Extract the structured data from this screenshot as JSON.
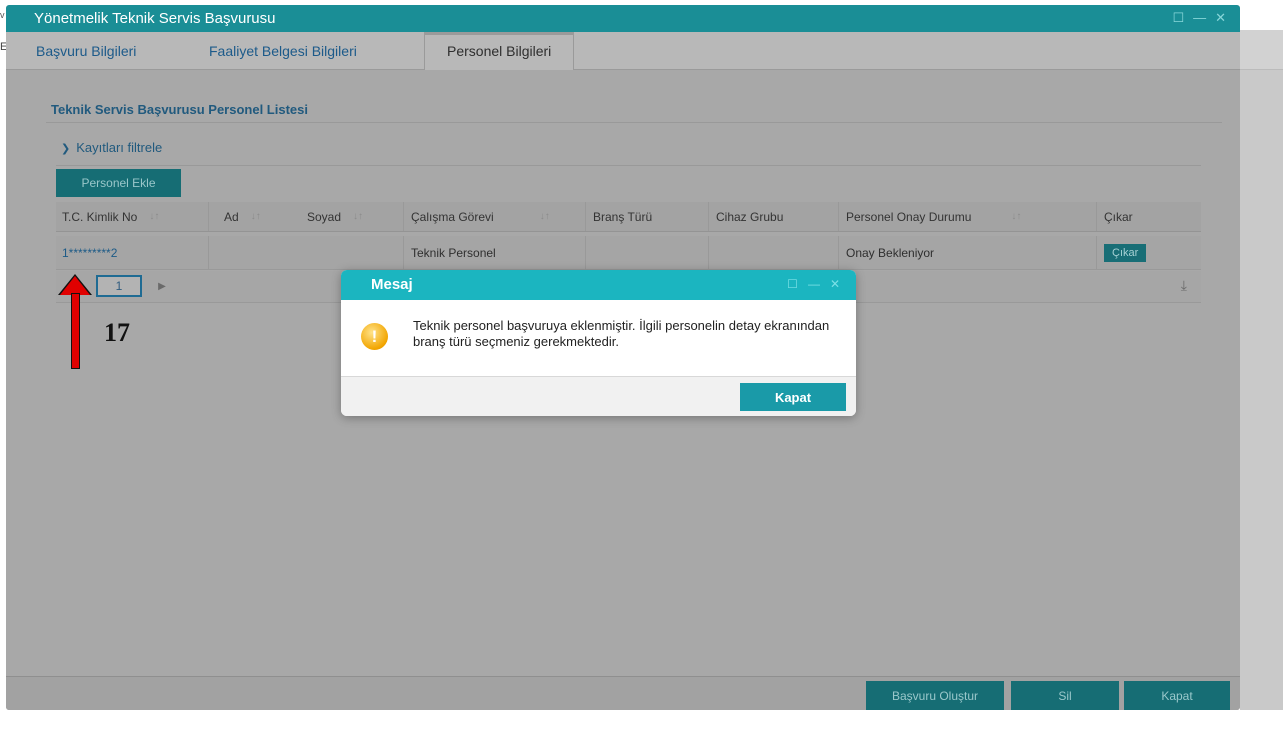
{
  "background": {
    "left_text_1": "v",
    "left_text_2": "E"
  },
  "window": {
    "title": "Yönetmelik Teknik Servis Başvurusu",
    "controls": [
      "☐",
      "—",
      "✕"
    ]
  },
  "tabs": [
    {
      "label": "Başvuru Bilgileri",
      "active": false
    },
    {
      "label": "Faaliyet Belgesi Bilgileri",
      "active": false
    },
    {
      "label": "Personel Bilgileri",
      "active": true
    }
  ],
  "section": {
    "title": "Teknik Servis Başvurusu Personel Listesi"
  },
  "filter": {
    "label": "Kayıtları filtrele",
    "icon": "chevron-down-icon"
  },
  "add_button": {
    "label": "Personel Ekle"
  },
  "table": {
    "columns": [
      "T.C. Kimlik No",
      "Ad",
      "Soyad",
      "Çalışma Görevi",
      "Branş Türü",
      "Cihaz Grubu",
      "Personel Onay Durumu",
      "Çıkar"
    ],
    "sort_glyph": "↓↑",
    "rows": [
      {
        "tc": "1*********2",
        "ad": "",
        "soyad": "",
        "gorev": "Teknik Personel",
        "brans": "",
        "cihaz": "",
        "durum": "Onay Bekleniyor",
        "action": "Çıkar"
      }
    ]
  },
  "pager": {
    "first": "◀",
    "page": "1",
    "next": "▶",
    "download": "⤓"
  },
  "footer": {
    "create_label": "Başvuru Oluştur",
    "delete_label": "Sil",
    "close_label": "Kapat"
  },
  "annotation": {
    "label": "17",
    "color": "#e00000"
  },
  "dialog": {
    "title": "Mesaj",
    "controls": [
      "☐",
      "—",
      "✕"
    ],
    "icon": "warning-icon",
    "icon_glyph": "!",
    "message": "Teknik personel başvuruya eklenmiştir. İlgili personelin detay ekranından branş türü seçmeniz gerekmektedir.",
    "button_label": "Kapat"
  },
  "colors": {
    "title_bar": "#1a8e96",
    "dialog_title": "#1bb5c0",
    "primary_button": "#166d74",
    "dialog_button": "#1a9aa8",
    "link": "#1d5b87"
  }
}
